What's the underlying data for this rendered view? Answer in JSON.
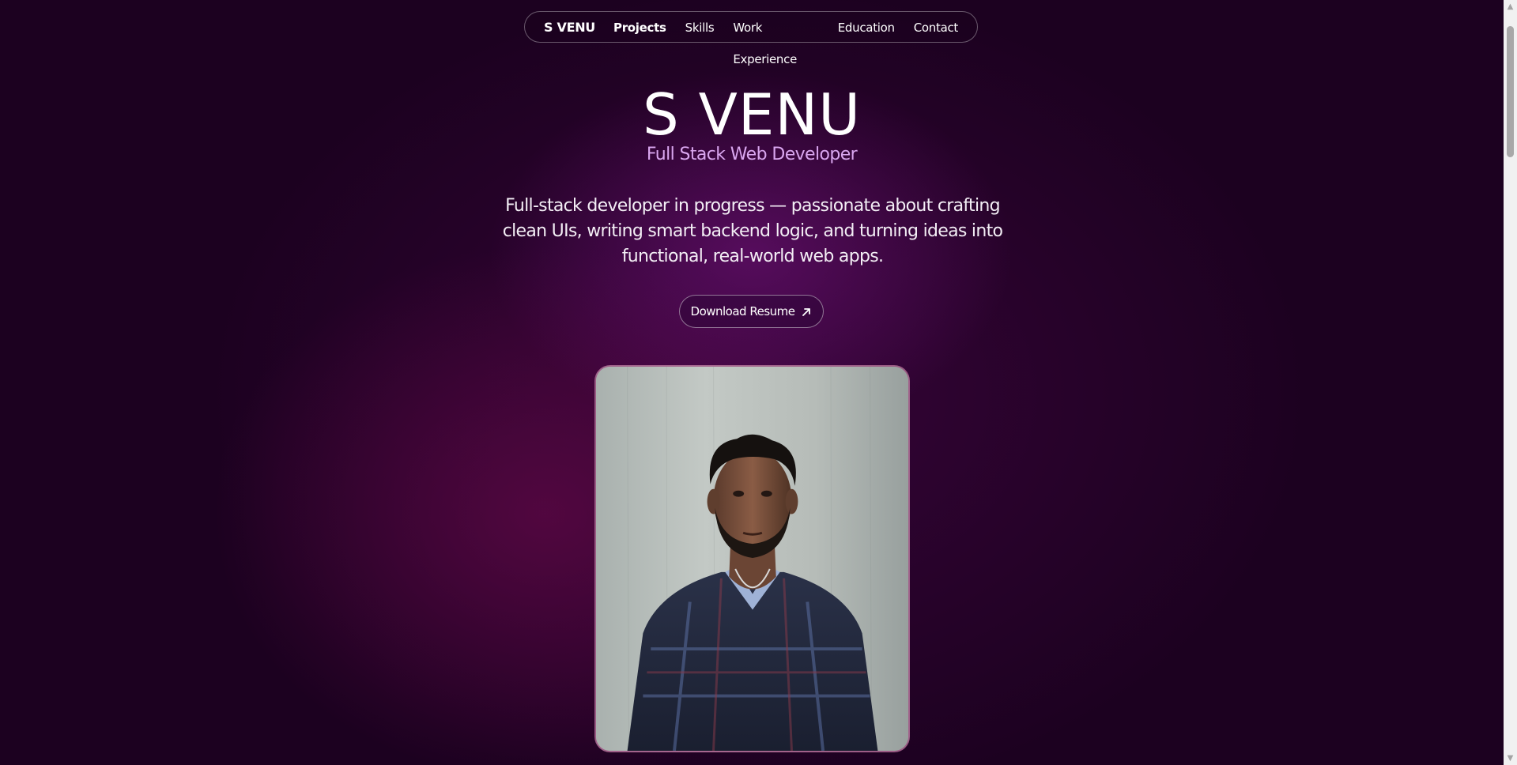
{
  "nav": {
    "brand": "S VENU",
    "links": [
      "Projects",
      "Skills",
      "Work Experience",
      "Education",
      "Contact"
    ],
    "active": "Projects"
  },
  "hero": {
    "name": "S VENU",
    "role": "Full Stack Web Developer",
    "description": "Full-stack developer in progress — passionate about crafting clean UIs, writing smart backend logic, and turning ideas into functional, real-world web apps.",
    "resume_button": "Download Resume",
    "resume_icon": "arrow-up-right-icon"
  },
  "colors": {
    "background": "#1c0120",
    "accent_role": "#d9a6ef",
    "frame_border": "#96286e"
  }
}
